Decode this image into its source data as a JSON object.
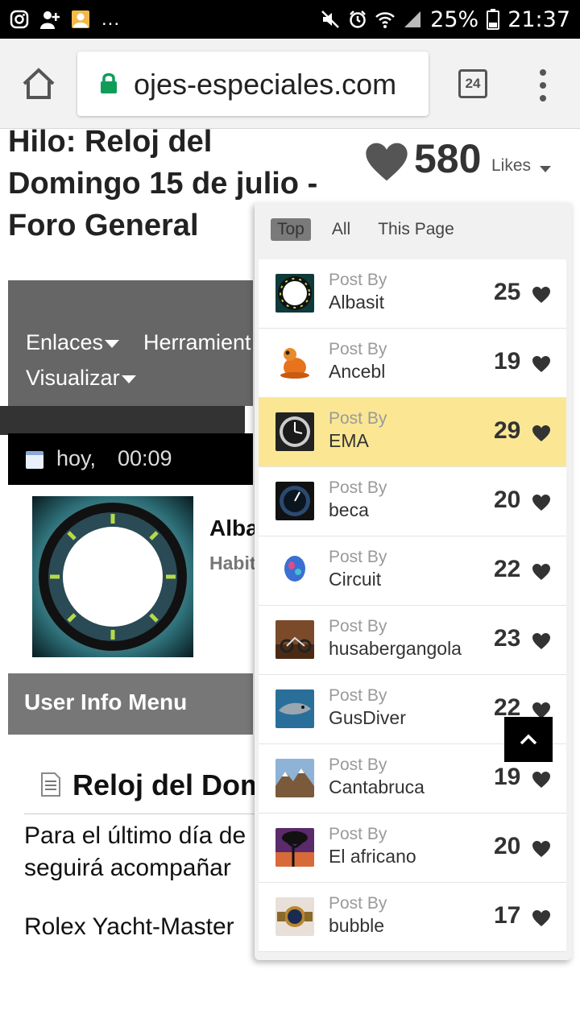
{
  "statusbar": {
    "battery": "25%",
    "time": "21:37",
    "more": "..."
  },
  "browser": {
    "url": "ojes-especiales.com",
    "tab_count": "24"
  },
  "page": {
    "title": "Hilo: Reloj del Domingo 15 de julio - Foro General",
    "nav": {
      "item1": "Enlaces",
      "item2": "Herramient",
      "item3": "Visualizar"
    },
    "date": {
      "today": "hoy,",
      "time": "00:09"
    },
    "author": {
      "name": "Alba",
      "rank": "Habit"
    },
    "user_info_menu": "User Info Menu",
    "post_title": "Reloj del Dom",
    "post_text1": "Para el último día de",
    "post_text1b": "seguirá acompañar",
    "post_text2": "Rolex Yacht-Master"
  },
  "likes": {
    "count": "580",
    "label": "Likes"
  },
  "dropdown": {
    "tabs": [
      "Top",
      "All",
      "This Page"
    ],
    "rows": [
      {
        "post_by": "Post By",
        "name": "Albasit",
        "count": "25"
      },
      {
        "post_by": "Post By",
        "name": "Ancebl",
        "count": "19"
      },
      {
        "post_by": "Post By",
        "name": "EMA",
        "count": "29"
      },
      {
        "post_by": "Post By",
        "name": "beca",
        "count": "20"
      },
      {
        "post_by": "Post By",
        "name": "Circuit",
        "count": "22"
      },
      {
        "post_by": "Post By",
        "name": "husabergangola",
        "count": "23"
      },
      {
        "post_by": "Post By",
        "name": "GusDiver",
        "count": "22"
      },
      {
        "post_by": "Post By",
        "name": "Cantabruca",
        "count": "19"
      },
      {
        "post_by": "Post By",
        "name": "El africano",
        "count": "20"
      },
      {
        "post_by": "Post By",
        "name": "bubble",
        "count": "17"
      }
    ]
  },
  "colors": {
    "highlight": "#fbe793",
    "tab_active": "#7a7a7a",
    "heart": "#333333"
  }
}
